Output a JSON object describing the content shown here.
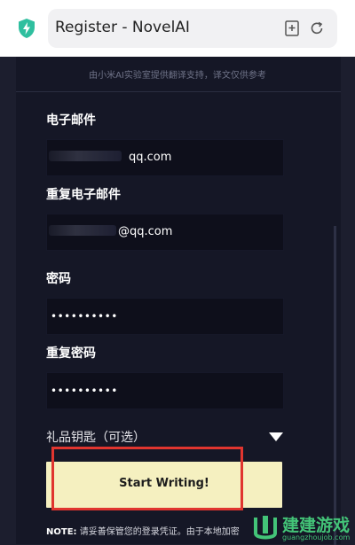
{
  "browser": {
    "tab_title": "Register - NovelAI",
    "shield_icon": "shield-bolt-icon",
    "bookmark_icon": "bookmark-add-icon",
    "reload_icon": "reload-icon",
    "accent_color": "#2fbf9f"
  },
  "translation_notice": "由小米AI实验室提供翻译支持，译文仅供参考",
  "form": {
    "email_label": "电子邮件",
    "email_value": "qq.com",
    "repeat_email_label": "重复电子邮件",
    "repeat_email_value": "@qq.com",
    "password_label": "密码",
    "password_value": "••••••••••",
    "repeat_password_label": "重复密码",
    "repeat_password_value": "••••••••••",
    "gift_key_label": "礼品钥匙（可选）",
    "submit_label": "Start Writing!",
    "submit_color": "#f5f0c0"
  },
  "note": {
    "prefix": "NOTE:",
    "text": " 请妥善保管您的登录凭证。由于本地加密"
  },
  "watermark": {
    "title": "建建游戏",
    "url": "guangzhoujob.com"
  }
}
